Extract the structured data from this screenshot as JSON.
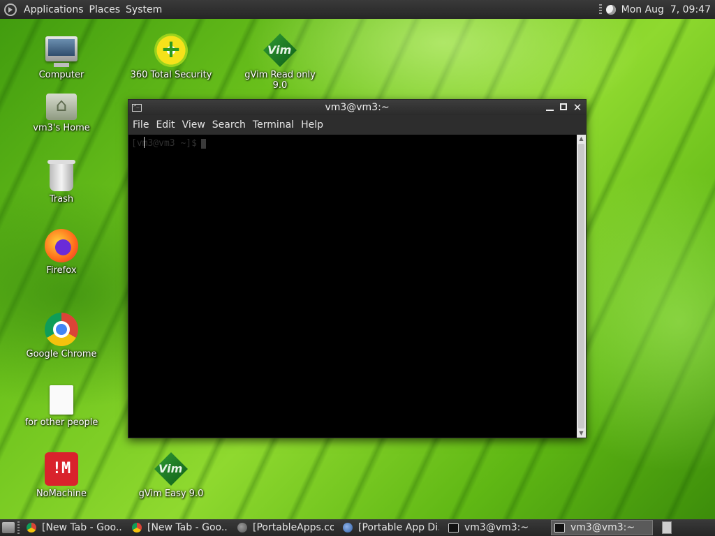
{
  "top_panel": {
    "menus": [
      "Applications",
      "Places",
      "System"
    ],
    "clock": "Mon Aug  7, 09:47",
    "icons": {
      "menu": "distro-logo-icon",
      "network": "network-status-icon"
    }
  },
  "desktop_icons": [
    {
      "label": "Computer",
      "icon": "computer-icon"
    },
    {
      "label": "vm3's Home",
      "icon": "home-folder-icon"
    },
    {
      "label": "Trash",
      "icon": "trash-icon"
    },
    {
      "label": "Firefox",
      "icon": "firefox-icon"
    },
    {
      "label": "Google Chrome",
      "icon": "chrome-icon"
    },
    {
      "label": "for other people",
      "icon": "document-icon"
    },
    {
      "label": "NoMachine",
      "icon": "nomachine-icon"
    },
    {
      "label": "360 Total Security",
      "icon": "360-security-icon"
    },
    {
      "label": "gVim Read only 9.0",
      "icon": "gvim-icon"
    },
    {
      "label": "gVim Easy 9.0",
      "icon": "gvim-icon"
    }
  ],
  "terminal": {
    "title": "vm3@vm3:~",
    "menu": [
      "File",
      "Edit",
      "View",
      "Search",
      "Terminal",
      "Help"
    ],
    "content": "[vm3@vm3 ~]$"
  },
  "taskbar": {
    "tasks": [
      {
        "label": "[New Tab - Goo...",
        "icon": "chrome-icon",
        "active": false
      },
      {
        "label": "[New Tab - Goo...",
        "icon": "chrome-icon",
        "active": false
      },
      {
        "label": "[PortableApps.co...",
        "icon": "globe-icon",
        "active": false
      },
      {
        "label": "[Portable App Di...",
        "icon": "web-icon",
        "active": false
      },
      {
        "label": "vm3@vm3:~",
        "icon": "terminal-icon",
        "active": false
      },
      {
        "label": "vm3@vm3:~",
        "icon": "terminal-icon",
        "active": true
      }
    ]
  }
}
